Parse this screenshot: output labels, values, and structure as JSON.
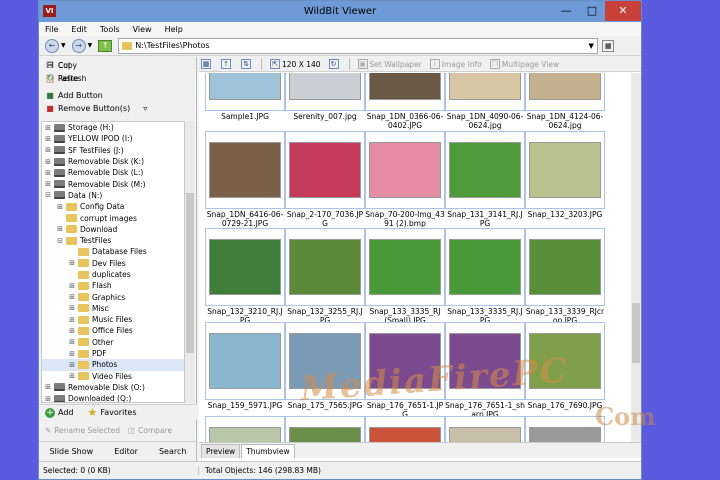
{
  "window": {
    "title": "WildBit Viewer",
    "app_icon_text": "VI"
  },
  "menu": [
    "File",
    "Edit",
    "Tools",
    "View",
    "Help"
  ],
  "address": {
    "path": "N:\\TestFiles\\Photos"
  },
  "left_actions": {
    "cut": "Cut",
    "copy": "Copy",
    "paste": "Paste",
    "refresh": "Refresh",
    "add_button": "Add Button",
    "remove_buttons": "Remove Button(s)"
  },
  "tree": [
    {
      "label": "Storage (H:)",
      "indent": 1,
      "exp": "+",
      "icon": "drive"
    },
    {
      "label": "YELLOW IPOD (I:)",
      "indent": 1,
      "exp": "+",
      "icon": "drive"
    },
    {
      "label": "SF TestFiles (J:)",
      "indent": 1,
      "exp": "+",
      "icon": "drive"
    },
    {
      "label": "Removable Disk (K:)",
      "indent": 1,
      "exp": "+",
      "icon": "drive"
    },
    {
      "label": "Removable Disk (L:)",
      "indent": 1,
      "exp": "+",
      "icon": "drive"
    },
    {
      "label": "Removable Disk (M:)",
      "indent": 1,
      "exp": "+",
      "icon": "drive"
    },
    {
      "label": "Data (N:)",
      "indent": 1,
      "exp": "−",
      "icon": "drive"
    },
    {
      "label": "Config Data",
      "indent": 2,
      "exp": "+",
      "icon": "folder"
    },
    {
      "label": "corrupt images",
      "indent": 2,
      "exp": "",
      "icon": "folder"
    },
    {
      "label": "Download",
      "indent": 2,
      "exp": "+",
      "icon": "folder"
    },
    {
      "label": "TestFiles",
      "indent": 2,
      "exp": "−",
      "icon": "folder"
    },
    {
      "label": "Database Files",
      "indent": 3,
      "exp": "",
      "icon": "folder"
    },
    {
      "label": "Dev Files",
      "indent": 3,
      "exp": "+",
      "icon": "folder"
    },
    {
      "label": "duplicates",
      "indent": 3,
      "exp": "",
      "icon": "folder"
    },
    {
      "label": "Flash",
      "indent": 3,
      "exp": "+",
      "icon": "folder"
    },
    {
      "label": "Graphics",
      "indent": 3,
      "exp": "+",
      "icon": "folder"
    },
    {
      "label": "Misc",
      "indent": 3,
      "exp": "+",
      "icon": "folder"
    },
    {
      "label": "Music Files",
      "indent": 3,
      "exp": "+",
      "icon": "folder"
    },
    {
      "label": "Office Files",
      "indent": 3,
      "exp": "+",
      "icon": "folder"
    },
    {
      "label": "Other",
      "indent": 3,
      "exp": "+",
      "icon": "folder"
    },
    {
      "label": "PDF",
      "indent": 3,
      "exp": "+",
      "icon": "folder"
    },
    {
      "label": "Photos",
      "indent": 3,
      "exp": "+",
      "icon": "folder",
      "selected": true
    },
    {
      "label": "Video Files",
      "indent": 3,
      "exp": "+",
      "icon": "folder"
    },
    {
      "label": "Removable Disk (O:)",
      "indent": 1,
      "exp": "+",
      "icon": "drive"
    },
    {
      "label": "Downloaded (Q:)",
      "indent": 1,
      "exp": "+",
      "icon": "drive"
    }
  ],
  "favbar": {
    "add": "Add",
    "favorites": "Favorites"
  },
  "rename_row": {
    "rename": "Rename Selected",
    "compare": "Compare"
  },
  "bottom_tabs": [
    "Slide Show",
    "Editor",
    "Search"
  ],
  "viewer_toolbar": {
    "size": "120 X 140",
    "wallpaper": "Set Wallpaper",
    "image_info": "Image Info",
    "multipage": "Multipage View"
  },
  "thumbnails": [
    {
      "name": "Sample1.JPG",
      "color": "#9ec3d8"
    },
    {
      "name": "Serenity_007.jpg",
      "color": "#c9cfd2"
    },
    {
      "name": "Snap_1DN_0366-06-0402.JPG",
      "color": "#6a5a45"
    },
    {
      "name": "Snap_1DN_4090-06-0624.jpg",
      "color": "#d7c7a5"
    },
    {
      "name": "Snap_1DN_4124-06-0624.jpg",
      "color": "#c3b08e"
    },
    {
      "name": "Snap_1DN_6416-06-0729-21.JPG",
      "color": "#7a6048"
    },
    {
      "name": "Snap_2-170_7036.JPG",
      "color": "#c43a5a"
    },
    {
      "name": "Snap_70-200-Img_4391 (2).bmp",
      "color": "#e48aa3"
    },
    {
      "name": "Snap_131_3141_RJ.JPG",
      "color": "#4f9a3a"
    },
    {
      "name": "Snap_132_3203.JPG",
      "color": "#b9c28f"
    },
    {
      "name": "Snap_132_3210_RJ.JPG",
      "color": "#3f7f3a"
    },
    {
      "name": "Snap_132_3255_RJ.JPG",
      "color": "#5d8a3a"
    },
    {
      "name": "Snap_133_3335_RJ (Small).JPG",
      "color": "#4a9a3a"
    },
    {
      "name": "Snap_133_3335_RJ.JPG",
      "color": "#4a9a3a"
    },
    {
      "name": "Snap_133_3339_RJcrop.JPG",
      "color": "#5a8f3a"
    },
    {
      "name": "Snap_159_5971.JPG",
      "color": "#8bb6cf"
    },
    {
      "name": "Snap_175_7565.JPG",
      "color": "#7a9ab5"
    },
    {
      "name": "Snap_176_7651-1.JPG",
      "color": "#7b4a8f"
    },
    {
      "name": "Snap_176_7651-1_sharp.JPG",
      "color": "#7b4a8f"
    },
    {
      "name": "Snap_176_7690.JPG",
      "color": "#7f9f4a"
    },
    {
      "name": "",
      "color": "#b7c7a8"
    },
    {
      "name": "",
      "color": "#6a8f4a"
    },
    {
      "name": "",
      "color": "#c9543a"
    },
    {
      "name": "",
      "color": "#c7bfa8"
    },
    {
      "name": "",
      "color": "#9a9a9a"
    }
  ],
  "view_tabs": [
    "Preview",
    "Thumbview"
  ],
  "status": {
    "selected": "Selected: 0 (0 KB)",
    "total": "Total Objects: 146 (298.83 MB)"
  },
  "watermark": {
    "line1": "MediaFirePC",
    "line2": "Com"
  }
}
